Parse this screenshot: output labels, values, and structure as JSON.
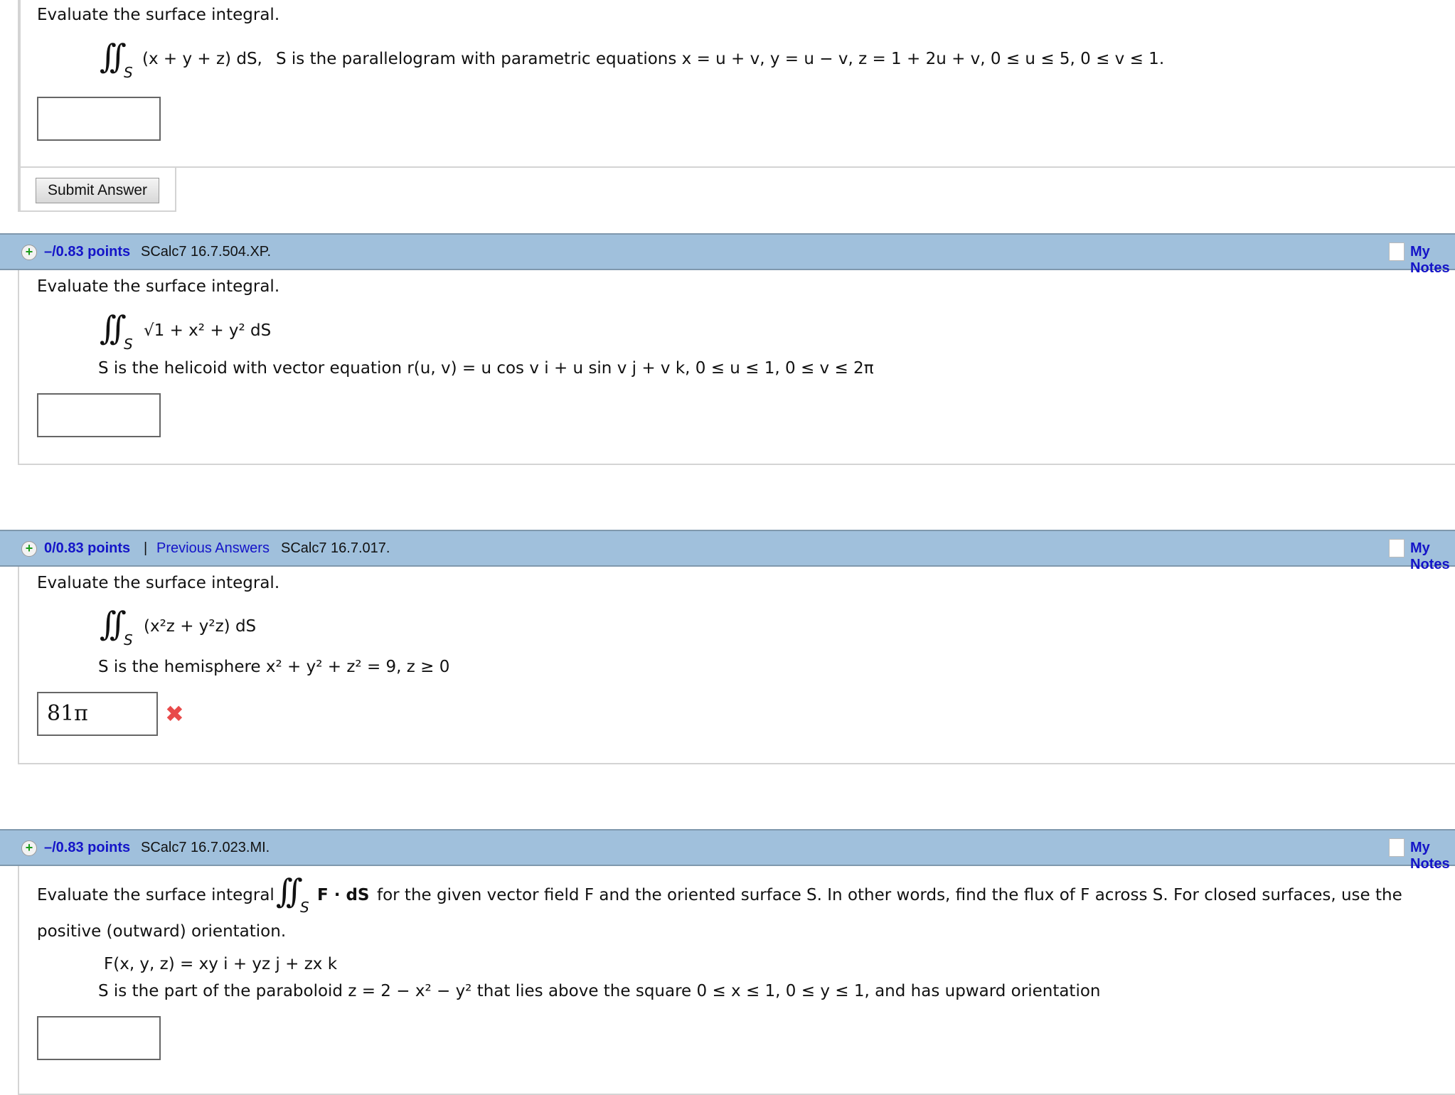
{
  "q1": {
    "prompt": "Evaluate the surface integral.",
    "integrand": "(x + y + z) dS,",
    "desc": "S is the parallelogram with parametric equations  x = u + v,   y = u − v,   z = 1 + 2u + v,   0 ≤ u ≤ 5,   0 ≤ v ≤ 1.",
    "answer": "",
    "submit": "Submit Answer"
  },
  "q2": {
    "points": "–/0.83 points",
    "code": "SCalc7 16.7.504.XP.",
    "notes": "My Notes",
    "prompt": "Evaluate the surface integral.",
    "integrand": "√1 + x² + y² dS",
    "desc": "S is the helicoid with vector equation  r(u, v) = u cos v i + u sin v j + v k, 0 ≤ u ≤ 1, 0 ≤ v ≤ 2π",
    "answer": ""
  },
  "q3": {
    "points": "0/0.83 points",
    "sep": "|",
    "prev": "Previous Answers",
    "code": "SCalc7 16.7.017.",
    "notes": "My Notes",
    "prompt": "Evaluate the surface integral.",
    "integrand": "(x²z + y²z) dS",
    "desc": "S is the hemisphere  x² + y² + z² = 9, z ≥ 0",
    "answer": "81π",
    "status": "incorrect"
  },
  "q4": {
    "points": "–/0.83 points",
    "code": "SCalc7 16.7.023.MI.",
    "notes": "My Notes",
    "prompt_a": "Evaluate the surface integral",
    "integrand": "F · dS",
    "prompt_b": "for the given vector field F and the oriented surface S. In other words, find the flux of F across S. For closed surfaces, use the",
    "prompt_c": "positive (outward) orientation.",
    "field": "F(x, y, z) = xy i + yz j + zx k",
    "desc": "S is the part of the paraboloid  z = 2 − x² − y² that lies above the square 0 ≤ x ≤ 1, 0 ≤ y ≤ 1,  and has upward orientation",
    "answer": ""
  },
  "colors": {
    "header": "#a0c0dc",
    "link": "#1414c8",
    "error": "#e84a4a"
  }
}
